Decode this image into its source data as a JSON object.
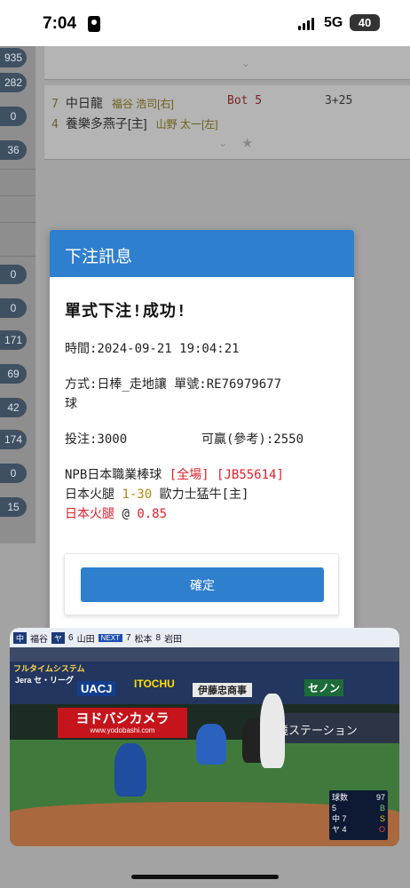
{
  "status_bar": {
    "time": "7:04",
    "network": "5G",
    "battery": "40"
  },
  "left_column": {
    "badges": [
      "935",
      "282",
      "0",
      "36",
      "0",
      "0",
      "171",
      "69",
      "42",
      "174",
      "0",
      "15"
    ]
  },
  "background_list": {
    "match": {
      "num_top": "7",
      "num_bottom": "4",
      "team_top": "中日龍",
      "pitcher_top": "福谷 浩司[右]",
      "team_bottom": "養樂多燕子[主]",
      "pitcher_bottom": "山野 太一[左]",
      "inning": "Bot 5",
      "score": "3+25"
    }
  },
  "modal": {
    "title": "下注訊息",
    "result": "單式下注!成功!",
    "time_line": "時間:2024-09-21 19:04:21",
    "method_line": "方式:日棒_走地讓 單號:RE76979677",
    "method_wrap": "球",
    "stake_label": "投注:3000",
    "win_label": "可贏(參考):2550",
    "league": "NPB日本職業棒球",
    "scope": "[全場]",
    "game_code": "[JB55614]",
    "home_team": "日本火腿",
    "handicap": "1-30",
    "away_team": "歐力士猛牛[主]",
    "pick_team": "日本火腿",
    "at": "@",
    "odds": "0.85",
    "confirm": "確定"
  },
  "video": {
    "topbar": {
      "team1": "中",
      "p1": "福谷",
      "tag1": "ヤ",
      "b6": "6",
      "batter6": "山田",
      "next": "NEXT",
      "b7": "7",
      "batter7": "松本",
      "b8": "8",
      "batter8": "岩田"
    },
    "ads": {
      "a1": "フルタイムシステム",
      "a2": "Jera セ・リーグ",
      "a3": "UACJ",
      "a4": "ITOCHU",
      "a5": "伊藤忠商事",
      "a6": "セノン",
      "a7": "ヨドバシカメラ",
      "a8": "www.yodobashi.com",
      "a9": "境ステーション"
    },
    "scoreboard": {
      "pitch_label": "球数",
      "pitch_count": "97",
      "inning": "5",
      "team_a": "中",
      "score_a": "7",
      "team_b": "ヤ",
      "score_b": "4",
      "b": "B",
      "s": "S",
      "o": "O"
    }
  },
  "colors": {
    "accent": "#2f7fcf",
    "danger": "#e0202a",
    "gold": "#b8860b"
  }
}
